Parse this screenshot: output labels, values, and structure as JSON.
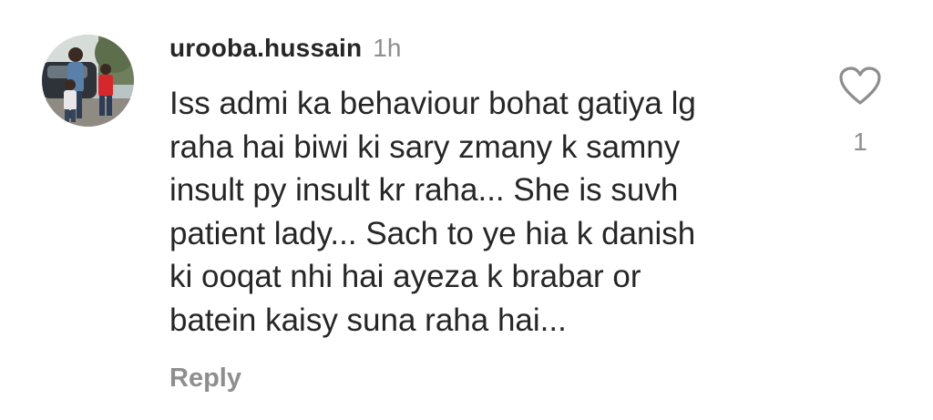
{
  "comment": {
    "username": "urooba.hussain",
    "time_ago": "1h",
    "avatar_icon": "profile-photo",
    "text_lines": [
      "Iss admi ka behaviour bohat gatiya lg",
      "raha hai biwi ki sary zmany k samny",
      "insult py insult kr raha... She is suvh",
      "patient lady... Sach to ye hia k danish",
      "ki ooqat nhi hai ayeza k brabar or",
      "batein kaisy suna raha hai..."
    ],
    "reply_label": "Reply",
    "like_icon": "heart-outline",
    "like_count": "1"
  },
  "colors": {
    "text_primary": "#262626",
    "text_secondary": "#8e8e8e",
    "background": "#ffffff"
  }
}
